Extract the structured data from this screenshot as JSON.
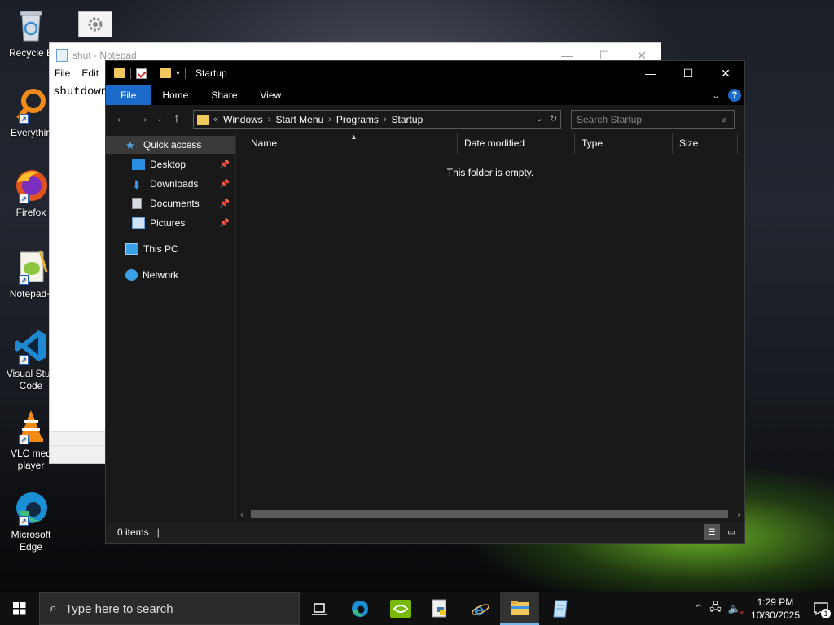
{
  "desktop": {
    "icons": [
      {
        "label": "Recycle B",
        "icon": "recycle-bin-icon"
      },
      {
        "label": "Everythin",
        "icon": "everything-search-icon"
      },
      {
        "label": "Firefox",
        "icon": "firefox-icon"
      },
      {
        "label": "Notepad+",
        "icon": "notepad-plus-plus-icon"
      },
      {
        "label": "Visual Stud Code",
        "icon": "vscode-icon"
      },
      {
        "label": "VLC med player",
        "icon": "vlc-icon"
      },
      {
        "label": "Microsoft Edge",
        "icon": "edge-icon"
      }
    ]
  },
  "notepad": {
    "title": "shut - Notepad",
    "menu": [
      "File",
      "Edit"
    ],
    "content": "shutdown"
  },
  "explorer": {
    "title": "Startup",
    "ribbon_tabs": {
      "file": "File",
      "home": "Home",
      "share": "Share",
      "view": "View"
    },
    "breadcrumb": {
      "overflow": "«",
      "items": [
        "Windows",
        "Start Menu",
        "Programs",
        "Startup"
      ]
    },
    "search_placeholder": "Search Startup",
    "nav": {
      "quick_access": "Quick access",
      "desktop": "Desktop",
      "downloads": "Downloads",
      "documents": "Documents",
      "pictures": "Pictures",
      "this_pc": "This PC",
      "network": "Network"
    },
    "columns": {
      "name": "Name",
      "date_modified": "Date modified",
      "type": "Type",
      "size": "Size"
    },
    "empty_message": "This folder is empty.",
    "status": "0 items"
  },
  "taskbar": {
    "search_placeholder": "Type here to search",
    "time": "1:29 PM",
    "date": "10/30/2025",
    "notification_count": "1"
  },
  "colors": {
    "accent": "#1b6ac9",
    "folder": "#f2c75c",
    "explorer_bg": "#191919"
  }
}
